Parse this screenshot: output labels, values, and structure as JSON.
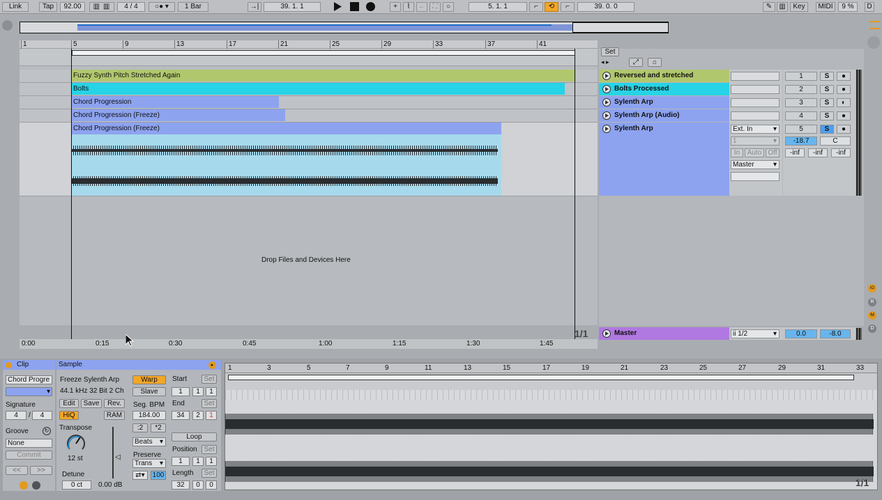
{
  "transport": {
    "link": "Link",
    "tap": "Tap",
    "tempo": "92.00",
    "signature": "4 / 4",
    "quant": "1 Bar",
    "position": "39.  1.  1",
    "loop_start": "5.  1.  1",
    "loop_length": "39.  0.  0",
    "key": "Key",
    "midi": "MIDI",
    "cpu": "9 %",
    "disk": "D"
  },
  "ruler": {
    "bars": [
      "1",
      "5",
      "9",
      "13",
      "17",
      "21",
      "25",
      "29",
      "33",
      "37",
      "41"
    ],
    "set_label": "Set"
  },
  "tracks": [
    {
      "clip": "Fuzzy Synth Pitch Stretched Again",
      "name": "Reversed and stretched",
      "num": "1",
      "color": "#b1c76d"
    },
    {
      "clip": "Bolts",
      "name": "Bolts Processed",
      "num": "2",
      "color": "#27d3e6"
    },
    {
      "clip": "Chord Progression",
      "name": "Sylenth Arp",
      "num": "3",
      "color": "#8da3f0"
    },
    {
      "clip": "Chord Progression (Freeze)",
      "name": "Sylenth Arp (Audio)",
      "num": "4",
      "color": "#8da3f0"
    },
    {
      "clip": "Chord Progression (Freeze)",
      "name": "Sylenth Arp",
      "num": "5",
      "color": "#8da3f0"
    }
  ],
  "track5": {
    "input": "Ext. In",
    "channel": "1",
    "in": "In",
    "auto": "Auto",
    "off": "Off",
    "output": "Master",
    "volume": "-18.7",
    "pan": "C",
    "meters": [
      "-inf",
      "-inf",
      "-inf"
    ],
    "solo": "S"
  },
  "solo": "S",
  "drop_text": "Drop Files and Devices Here",
  "page_indicator": "1/1",
  "master": {
    "name": "Master",
    "cue": "ii 1/2",
    "vol": "0.0",
    "vol2": "-8.0"
  },
  "time_ruler": [
    "0:00",
    "0:15",
    "0:30",
    "0:45",
    "1:00",
    "1:15",
    "1:30",
    "1:45"
  ],
  "clip_panel": {
    "title": "Clip",
    "name": "Chord Progre",
    "signature_label": "Signature",
    "sig_num": "4",
    "sig_sep": "/",
    "sig_den": "4",
    "groove_label": "Groove",
    "groove": "None",
    "commit": "Commit",
    "prev": "<<",
    "next": ">>"
  },
  "sample_panel": {
    "title": "Sample",
    "name": "Freeze Sylenth Arp",
    "info": "44.1 kHz 32 Bit 2 Ch",
    "edit": "Edit",
    "save": "Save",
    "rev": "Rev.",
    "hiq": "HiQ",
    "ram": "RAM",
    "transpose_label": "Transpose",
    "transpose": "12 st",
    "detune_label": "Detune",
    "detune": "0 ct",
    "gain": "0.00 dB",
    "warp": "Warp",
    "slave": "Slave",
    "segbpm_label": "Seg. BPM",
    "segbpm": "184.00",
    "half": ":2",
    "double": "*2",
    "mode": "Beats",
    "preserve_label": "Preserve",
    "preserve": "Trans",
    "ratio": "100",
    "start_label": "Start",
    "start": [
      "1",
      "1",
      "1"
    ],
    "end_label": "End",
    "end": [
      "34",
      "2",
      "1"
    ],
    "set": "Set",
    "loop": "Loop",
    "position_label": "Position",
    "position": [
      "1",
      "1",
      "1"
    ],
    "length_label": "Length",
    "length": [
      "32",
      "0",
      "0"
    ]
  },
  "sample_ruler": [
    "1",
    "3",
    "5",
    "7",
    "9",
    "11",
    "13",
    "15",
    "17",
    "19",
    "21",
    "23",
    "25",
    "27",
    "29",
    "31",
    "33"
  ],
  "sample_page": "1/1"
}
